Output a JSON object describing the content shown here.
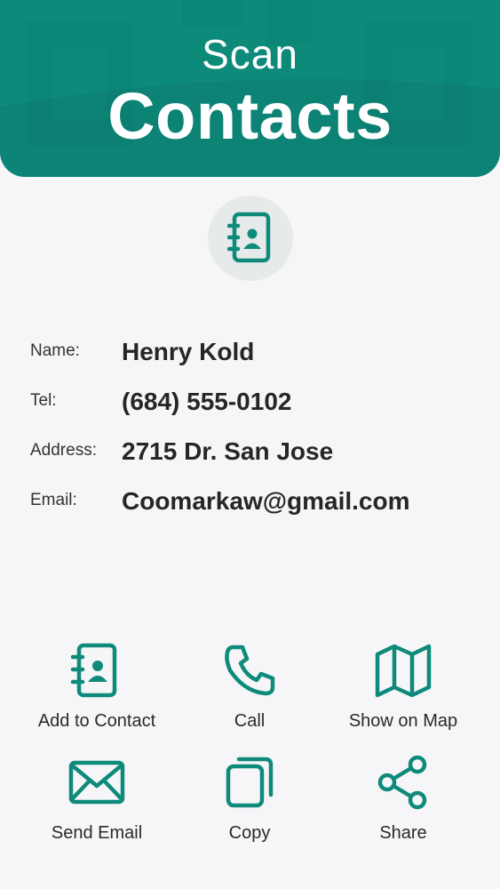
{
  "header": {
    "title_top": "Scan",
    "title_main": "Contacts"
  },
  "contact": {
    "name_label": "Name:",
    "name_value": "Henry Kold",
    "tel_label": "Tel:",
    "tel_value": "(684) 555-0102",
    "address_label": "Address:",
    "address_value": "2715 Dr. San Jose",
    "email_label": "Email:",
    "email_value": "Coomarkaw@gmail.com"
  },
  "actions": {
    "add_contact": "Add to Contact",
    "call": "Call",
    "show_map": "Show on Map",
    "send_email": "Send Email",
    "copy": "Copy",
    "share": "Share"
  },
  "colors": {
    "accent": "#0e8a7b",
    "background": "#f6f6f8",
    "text": "#262626"
  },
  "icons": [
    "address-book-icon",
    "phone-icon",
    "map-icon",
    "mail-icon",
    "copy-icon",
    "share-icon"
  ]
}
